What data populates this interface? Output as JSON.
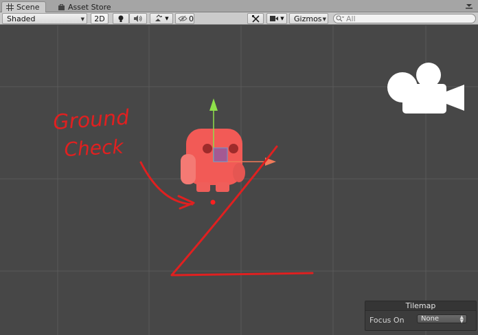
{
  "tabs": [
    {
      "label": "Scene",
      "icon": "grid-icon",
      "active": true
    },
    {
      "label": "Asset Store",
      "icon": "shopping-bag-icon",
      "active": false
    }
  ],
  "toolbar": {
    "draw_mode": "Shaded",
    "mode_2d": "2D",
    "hidden_count": "0",
    "gizmos": "Gizmos",
    "search_placeholder": "All"
  },
  "scene": {
    "annotation_line1": "Ground",
    "annotation_line2": "Check"
  },
  "tilemap_overlay": {
    "title": "Tilemap",
    "focus_label": "Focus On",
    "focus_value": "None"
  },
  "colors": {
    "viewport_bg": "#474747",
    "grid_line": "#5a5a5a",
    "annotation_red": "#e02020",
    "character_red": "#f25a56",
    "gizmo_green": "#8ee04a"
  }
}
